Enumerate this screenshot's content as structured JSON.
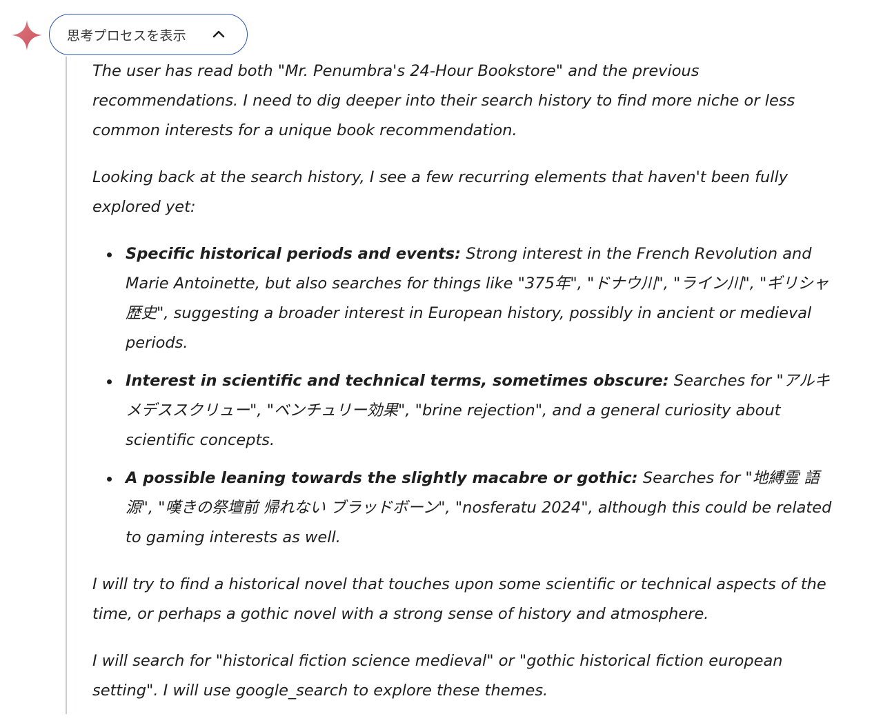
{
  "header": {
    "toggle_label": "思考プロセスを表示",
    "accent_color": "#2c55b0",
    "spark_color": "#d96570",
    "icons": [
      "gemini-spark-icon",
      "chevron-up-icon"
    ]
  },
  "thoughts": {
    "intro": "The user has read both \"Mr. Penumbra's 24-Hour Bookstore\" and the previous recommendations. I need to dig deeper into their search history to find more niche or less common interests for a unique book recommendation.",
    "looking_back": "Looking back at the search history, I see a few recurring elements that haven't been fully explored yet:",
    "bullets": [
      {
        "lead": "Specific historical periods and events:",
        "text": " Strong interest in the French Revolution and Marie Antoinette, but also searches for things like \"375年\", \"ドナウ川\", \"ライン川\", \"ギリシャ 歴史\", suggesting a broader interest in European history, possibly in ancient or medieval periods."
      },
      {
        "lead": "Interest in scientific and technical terms, sometimes obscure:",
        "text": " Searches for \"アルキメデススクリュー\", \"ベンチュリー効果\", \"brine rejection\", and a general curiosity about scientific concepts."
      },
      {
        "lead": "A possible leaning towards the slightly macabre or gothic:",
        "text": " Searches for \"地縛霊 語源\", \"嘆きの祭壇前 帰れない ブラッドボーン\", \"nosferatu 2024\", although this could be related to gaming interests as well."
      }
    ],
    "plan": "I will try to find a historical novel that touches upon some scientific or technical aspects of the time, or perhaps a gothic novel with a strong sense of history and atmosphere.",
    "search_plan": "I will search for \"historical fiction science medieval\" or \"gothic historical fiction european setting\". I will use google_search to explore these themes."
  }
}
